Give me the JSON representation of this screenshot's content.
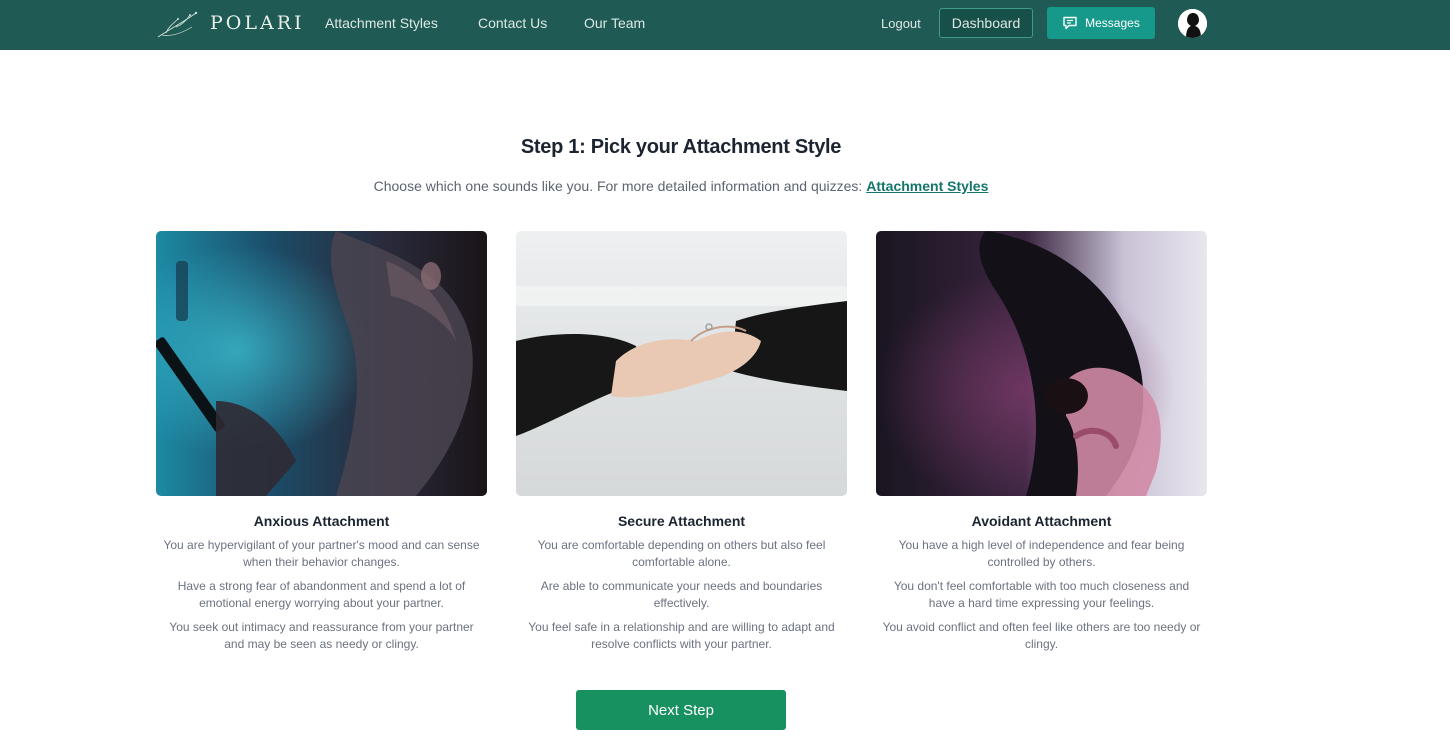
{
  "nav": {
    "logo_text": "POLARI",
    "links": [
      "Attachment Styles",
      "Contact Us",
      "Our Team"
    ],
    "logout_label": "Logout",
    "dashboard_label": "Dashboard",
    "messages_label": "Messages"
  },
  "main": {
    "title": "Step 1: Pick your Attachment Style",
    "subtitle_text": "Choose which one sounds like you. For more detailed information and quizzes: ",
    "subtitle_link": "Attachment Styles",
    "cards": [
      {
        "title": "Anxious Attachment",
        "lines": [
          "You are hypervigilant of your partner's mood and can sense when their behavior changes.",
          "Have a strong fear of abandonment and spend a lot of emotional energy worrying about your partner.",
          "You seek out intimacy and reassurance from your partner and may be seen as needy or clingy."
        ]
      },
      {
        "title": "Secure Attachment",
        "lines": [
          "You are comfortable depending on others but also feel comfortable alone.",
          "Are able to communicate your needs and boundaries effectively.",
          "You feel safe in a relationship and are willing to adapt and resolve conflicts with your partner."
        ]
      },
      {
        "title": "Avoidant Attachment",
        "lines": [
          "You have a high level of independence and fear being controlled by others.",
          "You don't feel comfortable with too much closeness and have a hard time expressing your feelings.",
          "You avoid conflict and often feel like others are too needy or clingy."
        ]
      }
    ],
    "next_label": "Next Step"
  },
  "colors": {
    "navbar_bg": "#1f5a54",
    "messages_bg": "#16998a",
    "next_button_bg": "#17915f",
    "link": "#13756c"
  },
  "icons": {
    "logo": "polari-branch-logo",
    "messages": "chat-bubble-icon",
    "avatar": "silhouette-avatar"
  }
}
